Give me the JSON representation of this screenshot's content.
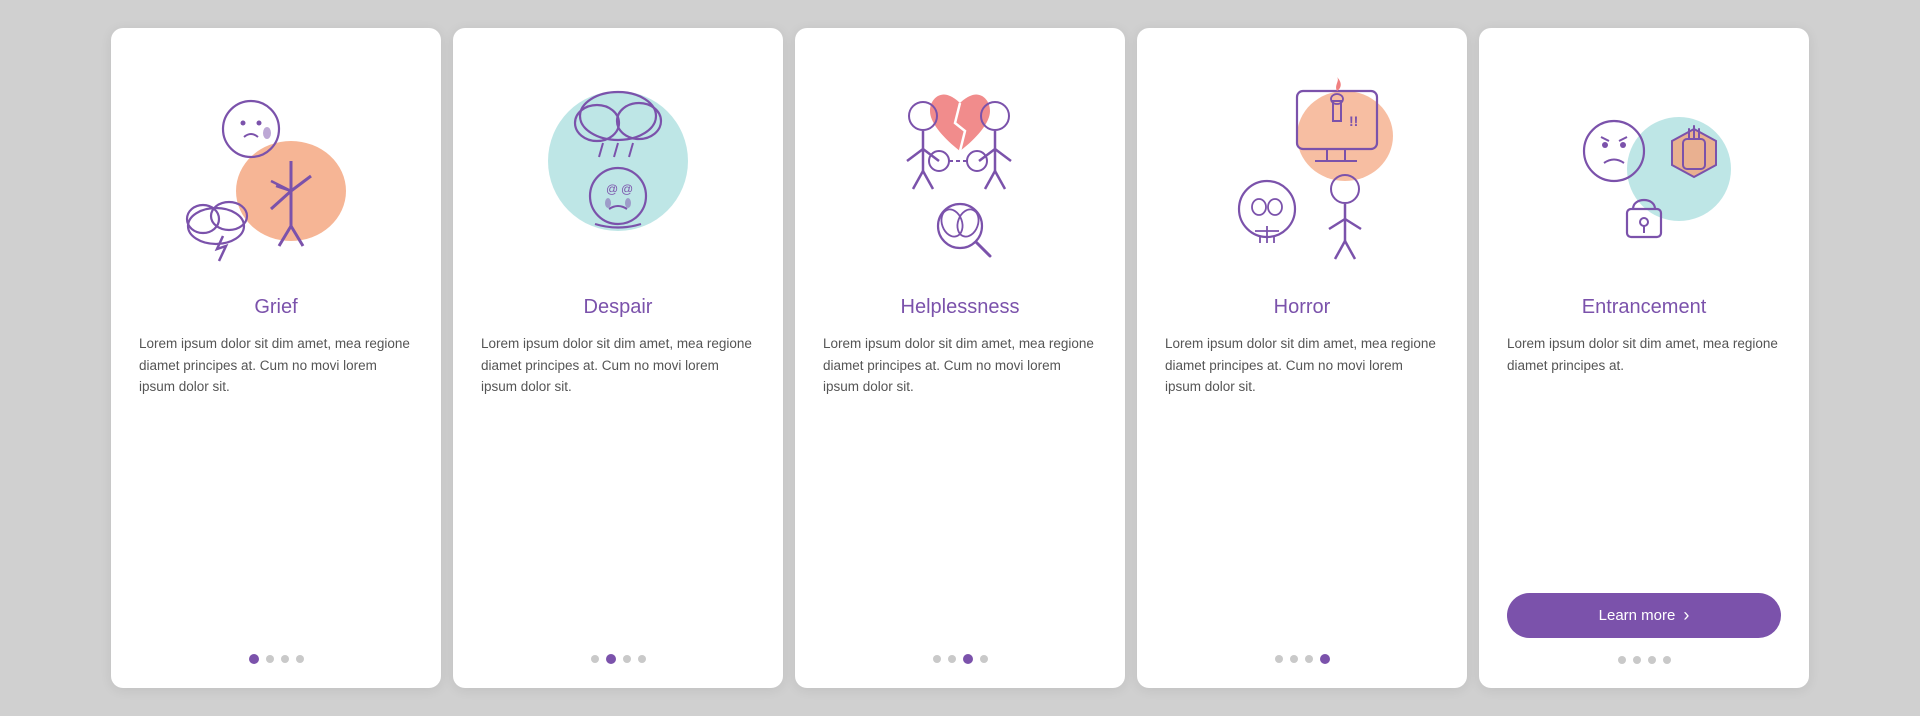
{
  "cards": [
    {
      "id": "grief",
      "title": "Grief",
      "body": "Lorem ipsum dolor sit dim amet, mea regione diamet principes at. Cum no movi lorem ipsum dolor sit.",
      "dots": [
        true,
        false,
        false,
        false
      ],
      "active_dot": 0,
      "illustration": "grief"
    },
    {
      "id": "despair",
      "title": "Despair",
      "body": "Lorem ipsum dolor sit dim amet, mea regione diamet principes at. Cum no movi lorem ipsum dolor sit.",
      "dots": [
        false,
        true,
        false,
        false
      ],
      "active_dot": 1,
      "illustration": "despair"
    },
    {
      "id": "helplessness",
      "title": "Helplessness",
      "body": "Lorem ipsum dolor sit dim amet, mea regione diamet principes at. Cum no movi lorem ipsum dolor sit.",
      "dots": [
        false,
        false,
        true,
        false
      ],
      "active_dot": 2,
      "illustration": "helplessness"
    },
    {
      "id": "horror",
      "title": "Horror",
      "body": "Lorem ipsum dolor sit dim amet, mea regione diamet principes at. Cum no movi lorem ipsum dolor sit.",
      "dots": [
        false,
        false,
        false,
        true
      ],
      "active_dot": 3,
      "illustration": "horror"
    },
    {
      "id": "entrancement",
      "title": "Entrancement",
      "body": "Lorem ipsum dolor sit dim amet, mea regione diamet principes at.",
      "dots": [
        false,
        false,
        false,
        false
      ],
      "active_dot": -1,
      "illustration": "entrancement",
      "has_button": true,
      "button_label": "Learn more"
    }
  ],
  "colors": {
    "purple": "#7b52ab",
    "pink_red": "#f08080",
    "teal": "#7ecece",
    "peach": "#f4a27a",
    "light_purple": "#c9aee8"
  }
}
